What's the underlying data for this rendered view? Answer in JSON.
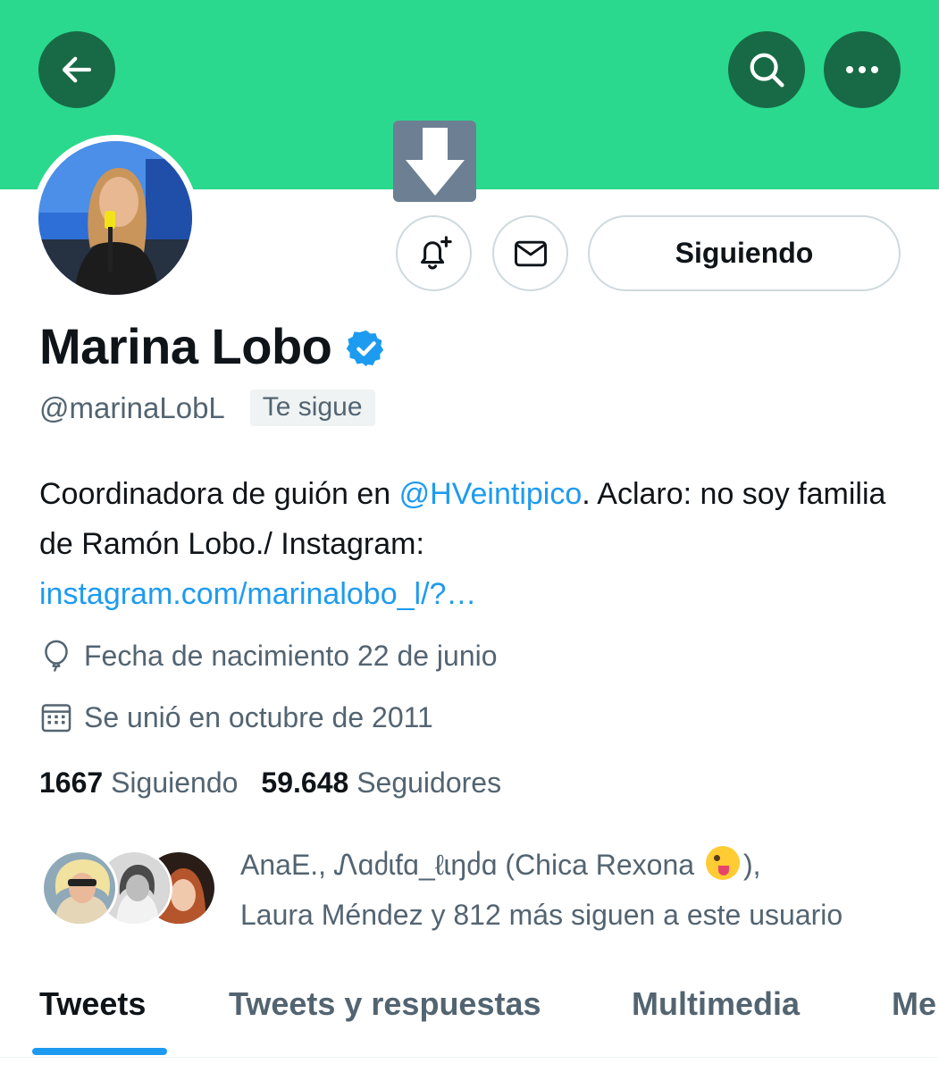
{
  "header": {
    "back": {
      "icon": "back-arrow-icon"
    },
    "search": {
      "icon": "search-icon"
    },
    "more": {
      "icon": "more-icon"
    },
    "banner_color": "#2ad98e",
    "button_color": "#176a45"
  },
  "overlay": {
    "icon": "download-arrow-icon"
  },
  "profile": {
    "name": "Marina Lobo",
    "verified_icon": "verified-badge-icon",
    "handle": "@marinaLobL",
    "follows_you": "Te sigue",
    "bio": {
      "text_1": "Coordinadora de guión en ",
      "mention": "@HVeintipico",
      "text_2": ". Aclaro: no soy familia de Ramón Lobo./ Instagram: ",
      "link": "instagram.com/marinalobo_l/?…"
    },
    "birthday": "Fecha de nacimiento 22 de junio",
    "joined": "Se unió en octubre de 2011"
  },
  "actions": {
    "notify_icon": "bell-plus-icon",
    "message_icon": "mail-icon",
    "follow_label": "Siguiendo"
  },
  "stats": {
    "following_count": "1667",
    "following_label": "Siguiendo",
    "followers_count": "59.648",
    "followers_label": "Seguidores"
  },
  "followed_by": {
    "text_1": "AnaE., Ꮑɑძɩƭɑ_ℓɩŋძɑ (Chica Rexona ",
    "emoji": "winking-face-with-tongue-emoji",
    "text_2": "),",
    "text_3": "Laura Méndez y 812 más siguen a este usuario"
  },
  "tabs": [
    {
      "label": "Tweets",
      "active": true
    },
    {
      "label": "Tweets y respuestas",
      "active": false
    },
    {
      "label": "Multimedia",
      "active": false
    },
    {
      "label": "Me",
      "active": false
    }
  ],
  "colors": {
    "accent": "#1d9bf0",
    "secondary_text": "#536471",
    "primary_text": "#0f1419"
  }
}
